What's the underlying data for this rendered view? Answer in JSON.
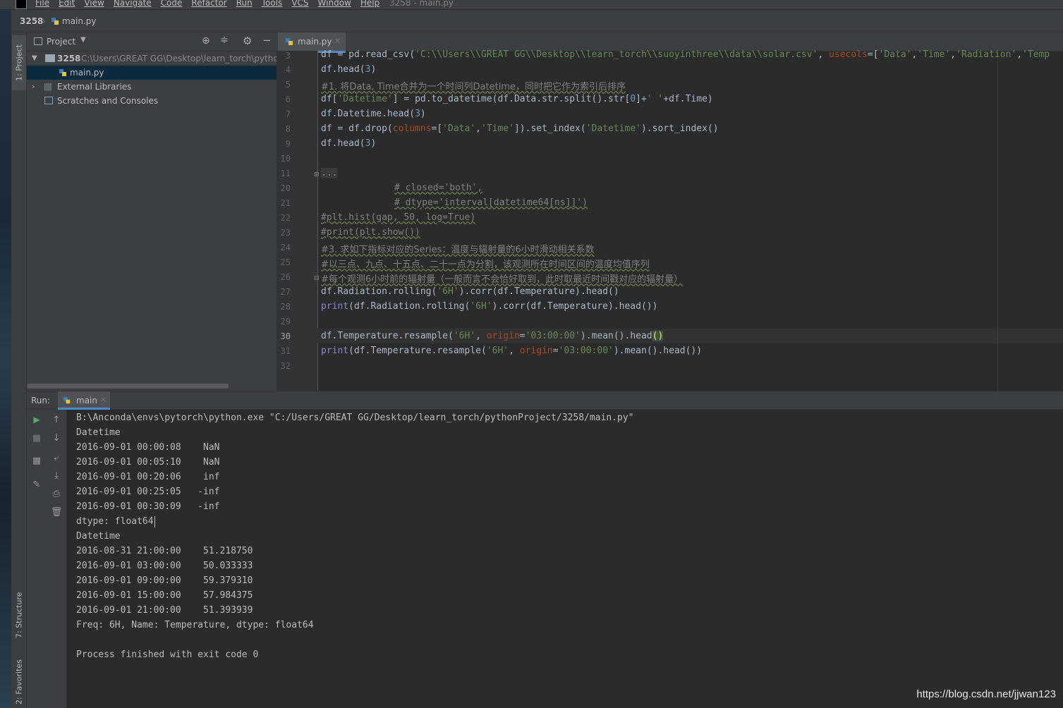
{
  "menubar": {
    "items": [
      "File",
      "Edit",
      "View",
      "Navigate",
      "Code",
      "Refactor",
      "Run",
      "Tools",
      "VCS",
      "Window",
      "Help"
    ],
    "window_title": "3258 - main.py"
  },
  "breadcrumb": {
    "project": "3258",
    "file": "main.py"
  },
  "left_strip": {
    "project_tab": "1: Project",
    "structure_tab": "7: Structure",
    "favorites_tab": "2: Favorites"
  },
  "project_panel": {
    "title": "Project",
    "root_name": "3258",
    "root_path": "C:\\Users\\GREAT GG\\Desktop\\learn_torch\\pytho",
    "file": "main.py",
    "external": "External Libraries",
    "scratches": "Scratches and Consoles"
  },
  "editor": {
    "tab": "main.py",
    "line_numbers": [
      "3",
      "4",
      "5",
      "6",
      "7",
      "8",
      "9",
      "10",
      "11",
      "20",
      "21",
      "22",
      "23",
      "24",
      "25",
      "26",
      "27",
      "28",
      "29",
      "30",
      "31",
      "32"
    ],
    "current_line": "30",
    "lines": {
      "l3_a": "df = pd.read_csv(",
      "l3_b": "'C:\\\\Users\\\\GREAT GG\\\\Desktop\\\\learn_torch\\\\suoyinthree\\\\data\\\\solar.csv'",
      "l3_c": ", ",
      "l3_d": "usecols",
      "l3_e": "=[",
      "l3_f": "'Data'",
      "l3_g": ",",
      "l3_h": "'Time'",
      "l3_i": ",",
      "l3_j": "'Radiation'",
      "l3_k": ",",
      "l3_l": "'Temp",
      "l4_a": "df.head(",
      "l4_b": "3",
      "l4_c": ")",
      "l5": "#1. 将Data, Time合并为一个时间列Datetime，同时把它作为索引后排序",
      "l6_a": "df[",
      "l6_b": "'Datetime'",
      "l6_c": "] = pd.to_datetime(df.Data.str.split().str[",
      "l6_d": "0",
      "l6_e": "]+",
      "l6_f": "' '",
      "l6_g": "+df.Time)",
      "l7_a": "df.Datetime.head(",
      "l7_b": "3",
      "l7_c": ")",
      "l8_a": "df = df.drop(",
      "l8_b": "columns",
      "l8_c": "=[",
      "l8_d": "'Data'",
      "l8_e": ",",
      "l8_f": "'Time'",
      "l8_g": "]).set_index(",
      "l8_h": "'Datetime'",
      "l8_i": ").sort_index()",
      "l9_a": "df.head(",
      "l9_b": "3",
      "l9_c": ")",
      "l11": "...",
      "l20": "# closed='both',",
      "l21": "# dtype='interval[datetime64[ns]]')",
      "l22": "#plt.hist(gap, 50, log=True)",
      "l23": "#print(plt.show())",
      "l24": "#3. 求如下指标对应的Series：温度与辐射量的6小时滑动相关系数",
      "l25": "#以三点、九点、十五点、二十一点为分割，该观测所在时间区间的温度均值序列",
      "l26": "#每个观测6小时前的辐射量（一般而言不会恰好取到，此时取最近时间戳对应的辐射量）",
      "l27_a": "df.Radiation.rolling(",
      "l27_b": "'6H'",
      "l27_c": ").corr(df.Temperature).head()",
      "l28_a": "print",
      "l28_b": "(df.Radiation.rolling(",
      "l28_c": "'6H'",
      "l28_d": ").corr(df.Temperature).head())",
      "l30_a": "df.Temperature.resample(",
      "l30_b": "'6H'",
      "l30_c": ", ",
      "l30_d": "origin",
      "l30_e": "=",
      "l30_f": "'03:00:00'",
      "l30_g": ").mean().head",
      "l30_h": "()",
      "l31_a": "print",
      "l31_b": "(df.Temperature.resample(",
      "l31_c": "'6H'",
      "l31_d": ", ",
      "l31_e": "origin",
      "l31_f": "=",
      "l31_g": "'03:00:00'",
      "l31_h": ").mean().head())"
    }
  },
  "run": {
    "label": "Run:",
    "tab": "main",
    "console": [
      "B:\\Anconda\\envs\\pytorch\\python.exe \"C:/Users/GREAT GG/Desktop/learn_torch/pythonProject/3258/main.py\"",
      "Datetime",
      "2016-09-01 00:00:08    NaN",
      "2016-09-01 00:05:10    NaN",
      "2016-09-01 00:20:06    inf",
      "2016-09-01 00:25:05   -inf",
      "2016-09-01 00:30:09   -inf",
      "dtype: float64",
      "Datetime",
      "2016-08-31 21:00:00    51.218750",
      "2016-09-01 03:00:00    50.033333",
      "2016-09-01 09:00:00    59.379310",
      "2016-09-01 15:00:00    57.984375",
      "2016-09-01 21:00:00    51.393939",
      "Freq: 6H, Name: Temperature, dtype: float64",
      "",
      "Process finished with exit code 0"
    ]
  },
  "watermark": "https://blog.csdn.net/jjwan123"
}
